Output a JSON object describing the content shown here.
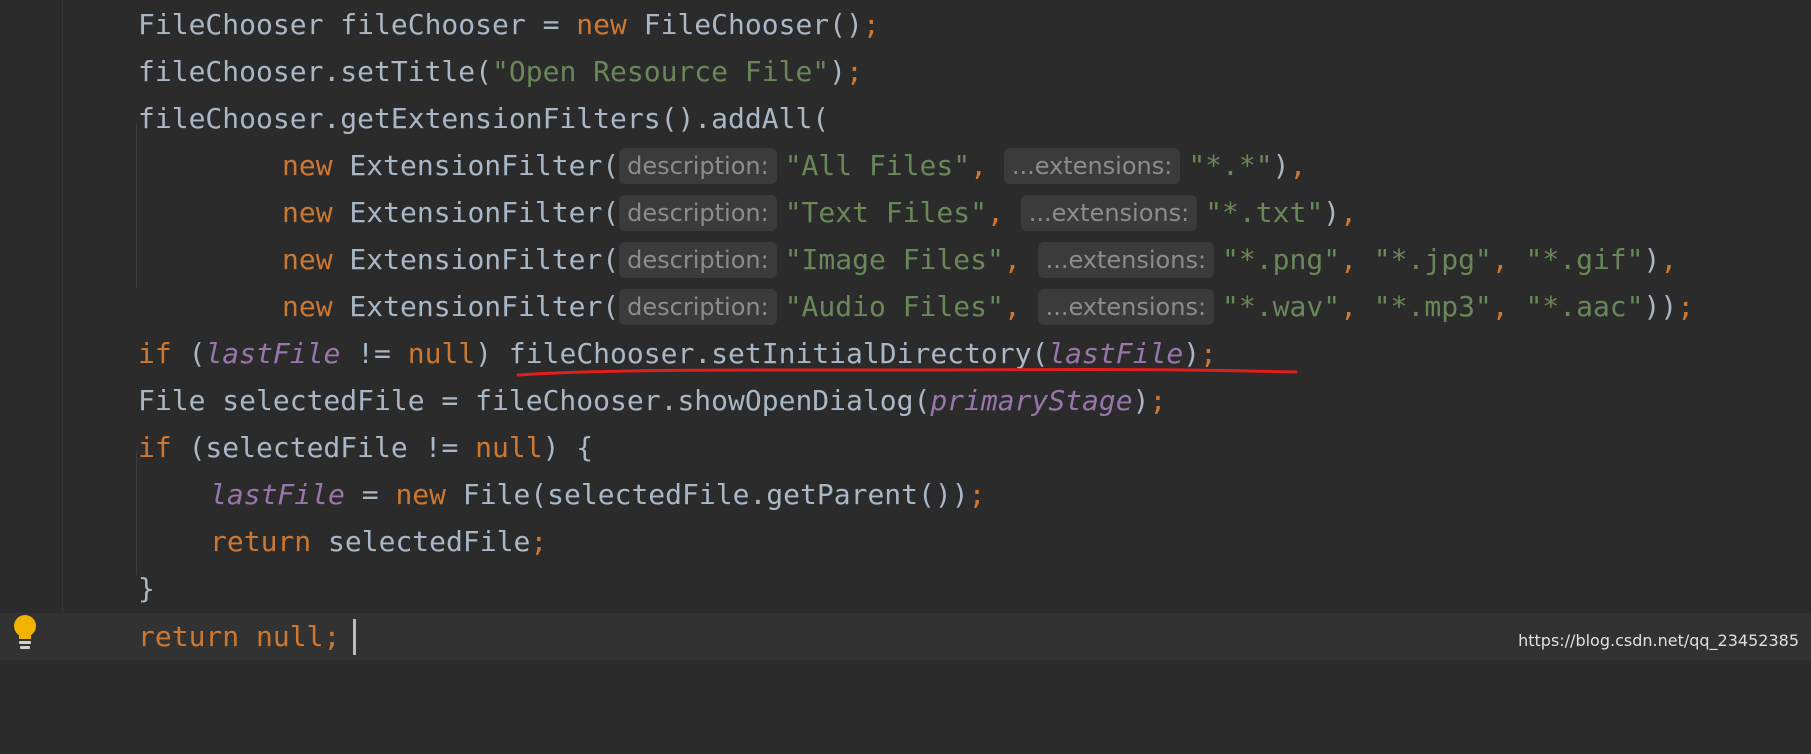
{
  "editor": {
    "lines": {
      "l1": {
        "t1": "FileChooser fileChooser = ",
        "t2": "new",
        "t3": " FileChooser()",
        "t4": ";"
      },
      "l2": {
        "t1": "fileChooser.setTitle(",
        "t2": "\"Open Resource File\"",
        "t3": ")",
        "t4": ";"
      },
      "l3": {
        "t1": "fileChooser.getExtensionFilters().addAll("
      },
      "l4": {
        "kw": "new",
        "fn": " ExtensionFilter(",
        "h1": "description:",
        "s1": "\"All Files\"",
        "c1": ",",
        "h2": "...extensions:",
        "s2": "\"*.*\"",
        "end": ")",
        "p": ","
      },
      "l5": {
        "kw": "new",
        "fn": " ExtensionFilter(",
        "h1": "description:",
        "s1": "\"Text Files\"",
        "c1": ",",
        "h2": "...extensions:",
        "s2": "\"*.txt\"",
        "end": ")",
        "p": ","
      },
      "l6": {
        "kw": "new",
        "fn": " ExtensionFilter(",
        "h1": "description:",
        "s1": "\"Image Files\"",
        "c1": ",",
        "h2": "...extensions:",
        "s2": "\"*.png\"",
        "c2": ", ",
        "s3": "\"*.jpg\"",
        "c3": ", ",
        "s4": "\"*.gif\"",
        "end": ")",
        "p": ","
      },
      "l7": {
        "kw": "new",
        "fn": " ExtensionFilter(",
        "h1": "description:",
        "s1": "\"Audio Files\"",
        "c1": ",",
        "h2": "...extensions:",
        "s2": "\"*.wav\"",
        "c2": ", ",
        "s3": "\"*.mp3\"",
        "c3": ", ",
        "s4": "\"*.aac\"",
        "end": "))",
        "p": ";"
      },
      "l8": {
        "kw1": "if",
        "t1": " (",
        "f1": "lastFile",
        "t2": " != ",
        "kw2": "null",
        "t3": ") fileChooser.setInitialDirectory(",
        "f2": "lastFile",
        "t4": ")",
        "p": ";"
      },
      "l9": {
        "t1": "File selectedFile = fileChooser.showOpenDialog(",
        "f1": "primaryStage",
        "t2": ")",
        "p": ";"
      },
      "l10": {
        "kw1": "if",
        "t1": " (selectedFile != ",
        "kw2": "null",
        "t2": ") {"
      },
      "l11": {
        "f1": "lastFile",
        "t1": " = ",
        "kw1": "new",
        "t2": " File(selectedFile.getParent())",
        "p": ";"
      },
      "l12": {
        "kw1": "return",
        "t1": " selectedFile",
        "p": ";"
      },
      "l13": {
        "t1": "}"
      },
      "l14": {
        "kw1": "return",
        "t1": " ",
        "kw2": "null",
        "p": ";"
      }
    },
    "colors": {
      "background": "#2b2b2b",
      "keyword": "#cc7832",
      "string": "#6a8759",
      "field": "#9876aa",
      "text": "#a9b7c6",
      "annotation_underline": "#e01e1e"
    },
    "gutter_icon": "lightbulb-icon"
  },
  "watermark": "https://blog.csdn.net/qq_23452385"
}
